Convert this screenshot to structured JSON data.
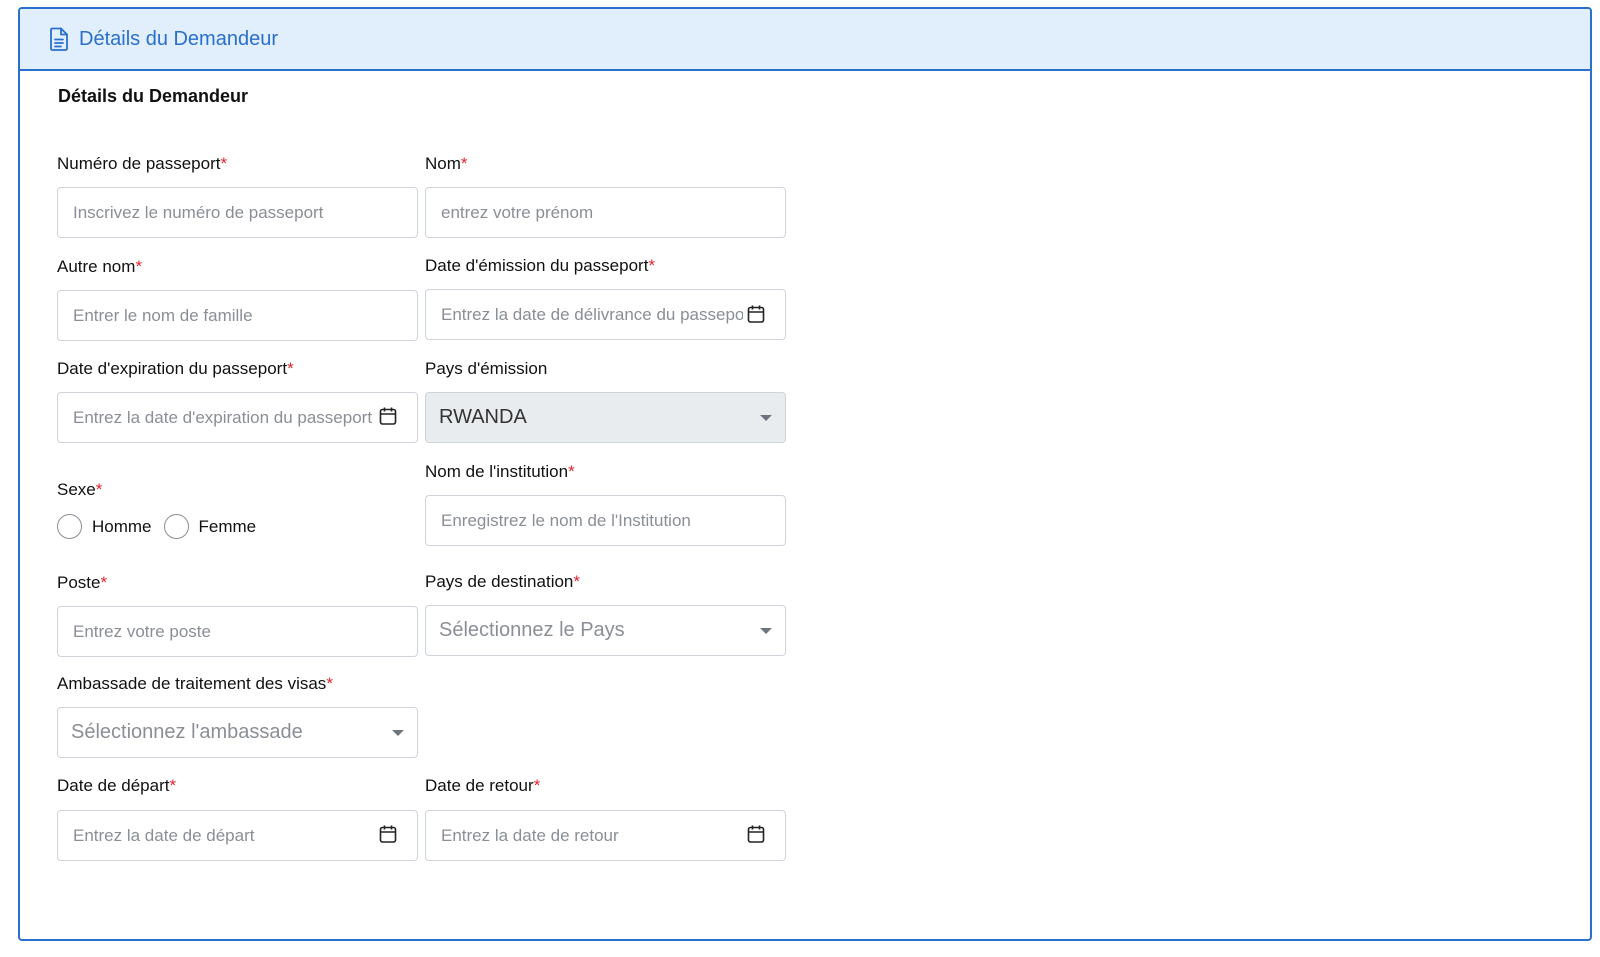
{
  "header": {
    "title": "Détails du Demandeur",
    "icon": "document-icon"
  },
  "section_title": "Détails du Demandeur",
  "required_marker": "*",
  "colors": {
    "accent": "#2a6fcb",
    "header_bg": "#e1eefb",
    "required": "#e0232e",
    "placeholder": "#8a8f95"
  },
  "fields": {
    "passport_number": {
      "label": "Numéro de passeport",
      "placeholder": "Inscrivez le numéro de passeport",
      "value": ""
    },
    "first_name": {
      "label": "Nom",
      "placeholder": "entrez votre prénom",
      "value": ""
    },
    "other_name": {
      "label": "Autre nom",
      "placeholder": "Entrer le nom de famille",
      "value": ""
    },
    "passport_issue_date": {
      "label": "Date d'émission du passeport",
      "placeholder": "Entrez la date de délivrance du passeport",
      "value": "",
      "icon": "calendar-icon"
    },
    "passport_expiry_date": {
      "label": "Date d'expiration du passeport",
      "placeholder": "Entrez la date d'expiration du passeport",
      "value": "",
      "icon": "calendar-icon"
    },
    "issuing_country": {
      "label": "Pays d'émission",
      "selected": "RWANDA"
    },
    "sex": {
      "label": "Sexe",
      "options": [
        "Homme",
        "Femme"
      ],
      "selected": ""
    },
    "institution_name": {
      "label": "Nom de l'institution",
      "placeholder": "Enregistrez le nom de l'Institution",
      "value": ""
    },
    "position": {
      "label": "Poste",
      "placeholder": "Entrez votre poste",
      "value": ""
    },
    "destination_country": {
      "label": "Pays de destination",
      "placeholder": "Sélectionnez le Pays"
    },
    "embassy": {
      "label": "Ambassade de traitement des visas",
      "placeholder": "Sélectionnez l'ambassade"
    },
    "departure_date": {
      "label": "Date de départ",
      "placeholder": "Entrez la date de départ",
      "value": "",
      "icon": "calendar-icon"
    },
    "return_date": {
      "label": "Date de retour",
      "placeholder": "Entrez la date de retour",
      "value": "",
      "icon": "calendar-icon"
    }
  }
}
